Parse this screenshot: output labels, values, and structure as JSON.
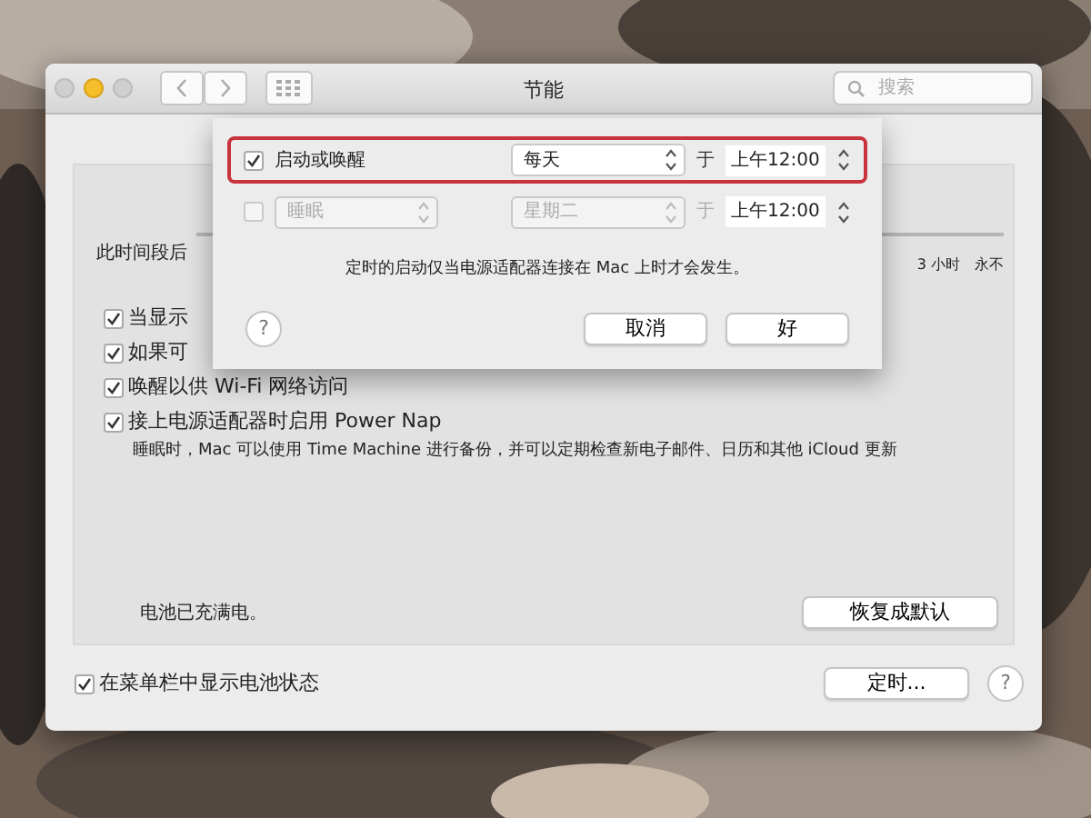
{
  "window": {
    "title": "节能",
    "search": {
      "placeholder": "搜索"
    }
  },
  "pane": {
    "slider_label": "此时间段后",
    "tick_labels": [
      "3 小时",
      "永不"
    ],
    "options": [
      {
        "label": "当显示",
        "checked": true
      },
      {
        "label": "如果可",
        "checked": true
      },
      {
        "label": "唤醒以供 Wi-Fi 网络访问",
        "checked": true
      },
      {
        "label": "接上电源适配器时启用 Power Nap",
        "checked": true,
        "description": "睡眠时，Mac 可以使用 Time Machine 进行备份，并可以定期检查新电子邮件、日历和其他 iCloud 更新"
      }
    ],
    "battery_status": "电池已充满电。",
    "restore_button": "恢复成默认"
  },
  "footer": {
    "menu_bar_option": {
      "label": "在菜单栏中显示电池状态",
      "checked": true
    },
    "schedule_button": "定时...",
    "help": "?"
  },
  "sheet": {
    "rows": [
      {
        "checked": true,
        "disabled": false,
        "highlighted": true,
        "action": "启动或唤醒",
        "day": "每天",
        "at": "于",
        "time": "上午12:00"
      },
      {
        "checked": false,
        "disabled": true,
        "highlighted": false,
        "action": "睡眠",
        "day": "星期二",
        "at": "于",
        "time": "上午12:00"
      }
    ],
    "note": "定时的启动仅当电源适配器连接在 Mac 上时才会发生。",
    "help": "?",
    "cancel": "取消",
    "ok": "好"
  }
}
